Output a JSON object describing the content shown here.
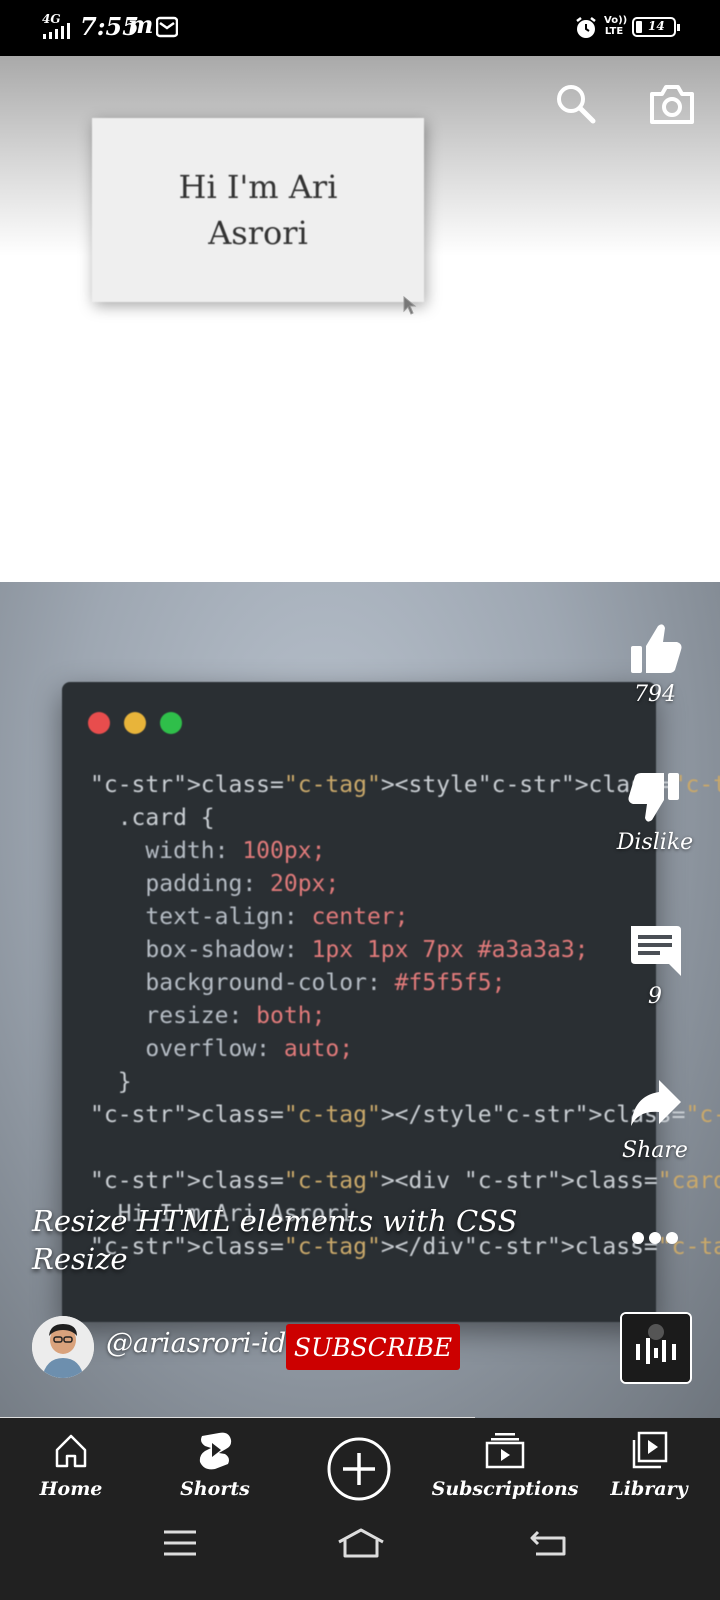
{
  "status_bar": {
    "network": "4G",
    "time": "7:55",
    "carrier_glyph": "m",
    "volte": "Vo)) LTE",
    "battery": "14"
  },
  "top_actions": {
    "search_icon": "search-icon",
    "camera_icon": "camera-icon"
  },
  "video": {
    "card_text_line1": "Hi I'm Ari",
    "card_text_line2": "Asrori",
    "code_lines": [
      "<style>",
      "  .card {",
      "    width: 100px;",
      "    padding: 20px;",
      "    text-align: center;",
      "    box-shadow: 1px 1px 7px #a3a3a3;",
      "    background-color: #f5f5f5;",
      "    resize: both;",
      "    overflow: auto;",
      "  }",
      "</style>",
      "",
      "<div class=\"card\">",
      "  Hi I'm Ari Asrori",
      "</div>"
    ]
  },
  "actions": {
    "like_count": "794",
    "dislike_label": "Dislike",
    "comment_count": "9",
    "share_label": "Share"
  },
  "short": {
    "title": "Resize HTML elements with CSS Resize",
    "channel": "@ariasrori-id",
    "subscribe_label": "SUBSCRIBE",
    "progress": 0.66
  },
  "nav": {
    "home": "Home",
    "shorts": "Shorts",
    "subscriptions": "Subscriptions",
    "library": "Library"
  },
  "colors": {
    "subscribe_red": "#cc0000",
    "nav_bg": "#212121"
  }
}
